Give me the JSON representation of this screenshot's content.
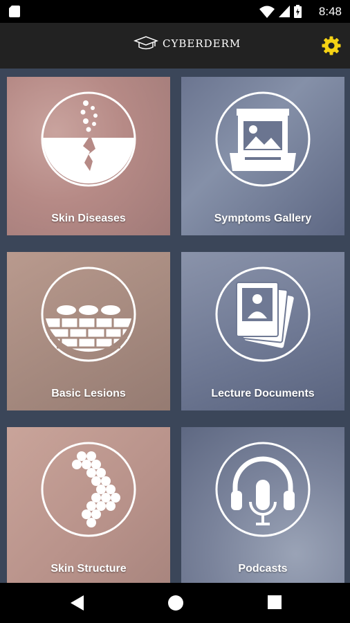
{
  "status_bar": {
    "time": "8:48"
  },
  "app": {
    "title": "CYBERDERM"
  },
  "tiles": [
    {
      "label": "Skin Diseases",
      "icon": "skin-diseases-icon"
    },
    {
      "label": "Symptoms Gallery",
      "icon": "image-gallery-icon"
    },
    {
      "label": "Basic Lesions",
      "icon": "skin-layers-icon"
    },
    {
      "label": "Lecture Documents",
      "icon": "documents-icon"
    },
    {
      "label": "Skin Structure",
      "icon": "skin-cells-icon"
    },
    {
      "label": "Podcasts",
      "icon": "headphones-microphone-icon"
    }
  ],
  "colors": {
    "accent": "#f5d214",
    "app_bar": "#222222",
    "background": "#3b4659"
  }
}
